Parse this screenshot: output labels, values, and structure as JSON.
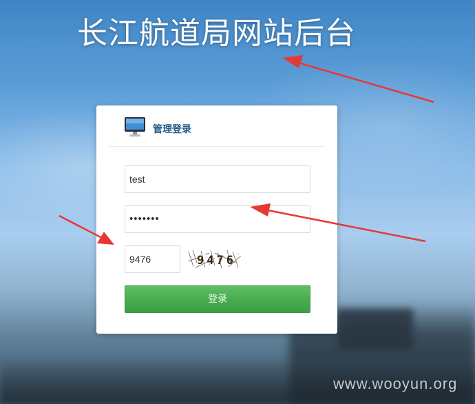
{
  "site": {
    "title": "长江航道局网站后台"
  },
  "login": {
    "header": "管理登录",
    "username_value": "test",
    "password_value": "•••••••",
    "captcha_value": "9476",
    "captcha_text": "9476",
    "submit_label": "登录"
  },
  "colors": {
    "accent_green": "#48ac4f",
    "header_blue": "#1f5a86",
    "annotation_red": "#e53935"
  },
  "watermark": "www.wooyun.org"
}
